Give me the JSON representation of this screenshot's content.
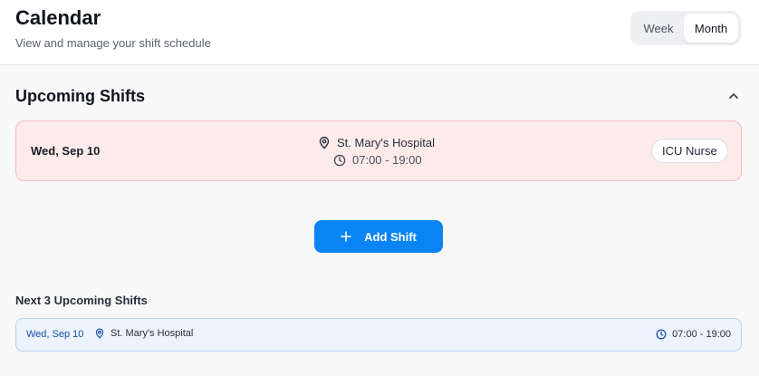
{
  "header": {
    "title": "Calendar",
    "subtitle": "View and manage your shift schedule",
    "view_options": [
      "Week",
      "Month"
    ],
    "selected_view": "Month"
  },
  "upcoming": {
    "title": "Upcoming Shifts",
    "toggle_icon": "chevron-up-icon",
    "shift": {
      "date": "Wed, Sep 10",
      "location": "St. Mary's Hospital",
      "time": "07:00 - 19:00",
      "role": "ICU Nurse",
      "location_icon": "map-pin-icon",
      "time_icon": "clock-icon"
    }
  },
  "actions": {
    "add_shift_label": "Add Shift",
    "add_icon": "plus-icon"
  },
  "next": {
    "title": "Next 3 Upcoming Shifts",
    "items": [
      {
        "date": "Wed, Sep 10",
        "location": "St. Mary's Hospital",
        "time": "07:00 - 19:00"
      }
    ]
  },
  "colors": {
    "accent": "#0a84f5",
    "shift_card_bg": "#fdebeb",
    "shift_card_border": "#f3b9bd",
    "next_row_bg": "#ecf3fd",
    "next_row_border": "#b9d2f2"
  }
}
